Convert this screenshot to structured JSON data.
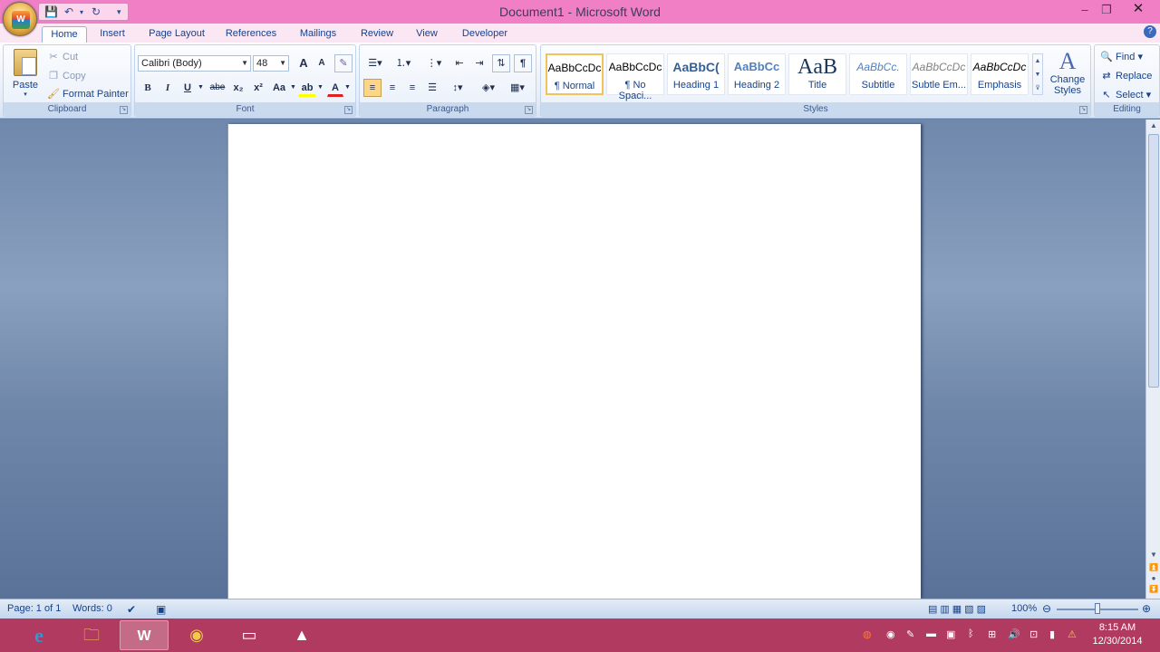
{
  "window": {
    "title": "Document1 - Microsoft Word",
    "minimize": "–",
    "restore": "❐",
    "close": "✕"
  },
  "office_button": {
    "logo": "W"
  },
  "qat": {
    "save": "💾",
    "undo": "↶",
    "redo": "↻",
    "customize": "▾"
  },
  "tabs": [
    "Home",
    "Insert",
    "Page Layout",
    "References",
    "Mailings",
    "Review",
    "View",
    "Developer"
  ],
  "active_tab": "Home",
  "help": "?",
  "clipboard": {
    "label": "Clipboard",
    "paste": "Paste",
    "cut": "Cut",
    "copy": "Copy",
    "format_painter": "Format Painter"
  },
  "font": {
    "label": "Font",
    "name": "Calibri (Body)",
    "size": "48",
    "buttons": {
      "grow": "A",
      "shrink": "A",
      "clear": "✎",
      "bold": "B",
      "italic": "I",
      "underline": "U",
      "strike": "abe",
      "sub": "x₂",
      "sup": "x²",
      "case": "Aa",
      "highlight": "ab",
      "color": "A"
    }
  },
  "paragraph": {
    "label": "Paragraph",
    "pilcrow": "¶"
  },
  "styles": {
    "label": "Styles",
    "items": [
      {
        "sample": "AaBbCcDc",
        "name": "¶ Normal"
      },
      {
        "sample": "AaBbCcDc",
        "name": "¶ No Spaci..."
      },
      {
        "sample": "AaBbC(",
        "name": "Heading 1"
      },
      {
        "sample": "AaBbCc",
        "name": "Heading 2"
      },
      {
        "sample": "AaB",
        "name": "Title"
      },
      {
        "sample": "AaBbCc.",
        "name": "Subtitle"
      },
      {
        "sample": "AaBbCcDc",
        "name": "Subtle Em..."
      },
      {
        "sample": "AaBbCcDc",
        "name": "Emphasis"
      }
    ],
    "change_styles": "Change Styles"
  },
  "editing": {
    "label": "Editing",
    "find": "Find",
    "replace": "Replace",
    "select": "Select"
  },
  "status": {
    "page": "Page: 1 of 1",
    "words": "Words: 0",
    "zoom": "100%",
    "zoom_fraction": 0.5
  },
  "taskbar": {
    "time": "8:15 AM",
    "date": "12/30/2014"
  },
  "colors": {
    "title_bar": "#f07fc6",
    "taskbar": "#b03a60",
    "ribbon_text": "#15428b"
  }
}
